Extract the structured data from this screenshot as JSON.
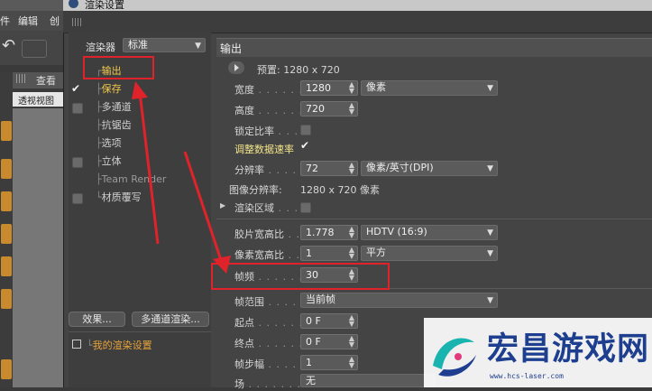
{
  "host": {
    "menu": [
      "件",
      "编辑",
      "创"
    ],
    "view_tab": "查看",
    "view_title": "透视视图"
  },
  "dialog": {
    "title": "渲染设置",
    "renderer_label": "渲染器",
    "renderer_value": "标准",
    "tree": [
      {
        "label": "输出",
        "checked": null,
        "selected": true
      },
      {
        "label": "保存",
        "checked": true,
        "selected": false
      },
      {
        "label": "多通道",
        "checked": false,
        "selected": false
      },
      {
        "label": "抗锯齿",
        "checked": null,
        "selected": false
      },
      {
        "label": "选项",
        "checked": null,
        "selected": false
      },
      {
        "label": "立体",
        "checked": false,
        "selected": false
      },
      {
        "label": "Team Render",
        "checked": null,
        "selected": false
      },
      {
        "label": "材质覆写",
        "checked": false,
        "selected": false
      }
    ],
    "effects_button": "效果...",
    "multipass_button": "多通道渲染...",
    "preset_name": "我的渲染设置"
  },
  "output": {
    "section_title": "输出",
    "preset_label": "预置: 1280 x 720",
    "width_label": "宽度",
    "width_value": "1280",
    "width_unit": "像素",
    "height_label": "高度",
    "height_value": "720",
    "lock_ratio_label": "锁定比率",
    "adjust_rate_label": "调整数据速率",
    "resolution_label": "分辨率",
    "resolution_value": "72",
    "resolution_unit": "像素/英寸(DPI)",
    "image_resolution_label": "图像分辨率:",
    "image_resolution_value": "1280 x 720 像素",
    "render_region_label": "渲染区域",
    "film_aspect_label": "胶片宽高比",
    "film_aspect_value": "1.778",
    "film_aspect_preset": "HDTV (16:9)",
    "pixel_aspect_label": "像素宽高比",
    "pixel_aspect_value": "1",
    "pixel_aspect_preset": "平方",
    "fps_label": "帧频",
    "fps_value": "30",
    "frame_range_label": "帧范围",
    "frame_range_value": "当前帧",
    "start_label": "起点",
    "start_value": "0 F",
    "end_label": "终点",
    "end_value": "0 F",
    "step_label": "帧步幅",
    "step_value": "1",
    "field_label": "场",
    "field_value": "无"
  },
  "watermark": {
    "text": "宏昌游戏网",
    "url": "www.hcs-laser.com"
  },
  "colors": {
    "annotation_red": "#e0232a",
    "highlight_text": "#f2e58a",
    "preset_orange": "#e8a33a",
    "watermark_blue": "#1e3f8f"
  }
}
